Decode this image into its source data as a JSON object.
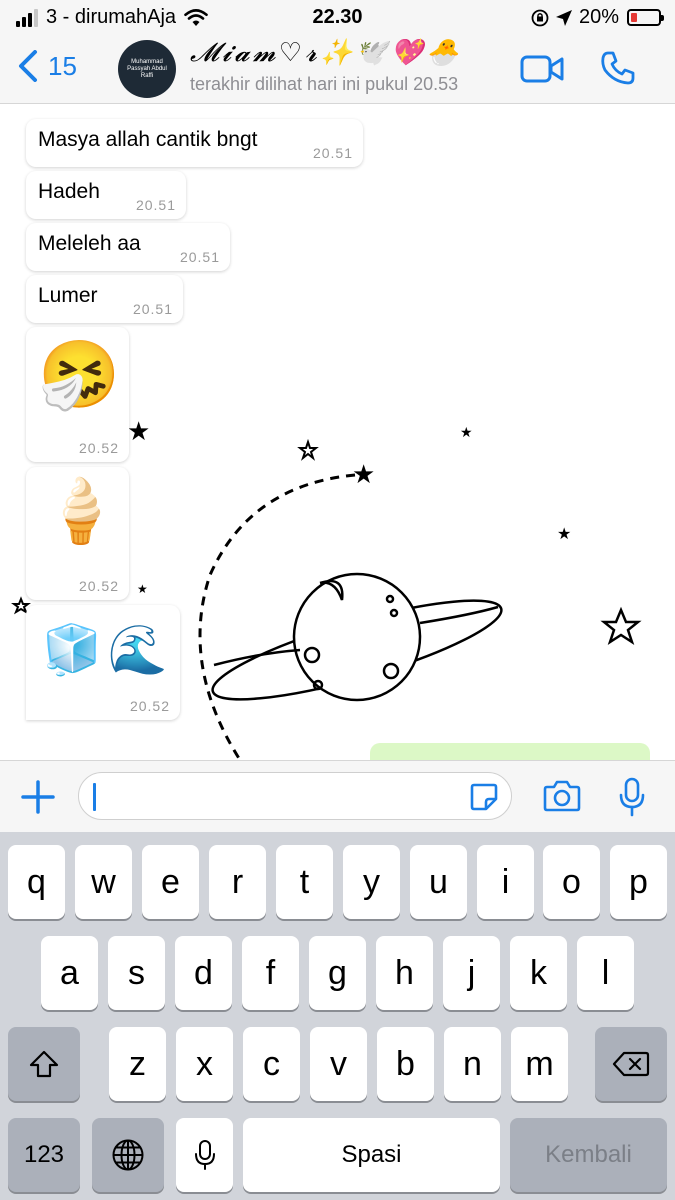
{
  "status_bar": {
    "carrier": "3 - dirumahAja",
    "time": "22.30",
    "battery": "20%"
  },
  "header": {
    "back_count": "15",
    "avatar_text": "Muhammad Passyah Abdul Raffi",
    "contact_name": "𝓜𝓲𝓪𝓶♡𝓻✨🕊️💖🐣",
    "last_seen": "terakhir dilihat hari ini pukul 20.53"
  },
  "messages": [
    {
      "text": "Masya allah cantik bngt",
      "time": "20.51"
    },
    {
      "text": "Hadeh",
      "time": "20.51"
    },
    {
      "text": "Meleleh aa",
      "time": "20.51"
    },
    {
      "text": "Lumer",
      "time": "20.51"
    },
    {
      "emoji": "🤧",
      "time": "20.52"
    },
    {
      "emoji": "🍦",
      "time": "20.52"
    },
    {
      "emoji": "🧊🌊",
      "time": "20.52"
    }
  ],
  "keyboard": {
    "row1": [
      "q",
      "w",
      "e",
      "r",
      "t",
      "y",
      "u",
      "i",
      "o",
      "p"
    ],
    "row2": [
      "a",
      "s",
      "d",
      "f",
      "g",
      "h",
      "j",
      "k",
      "l"
    ],
    "row3": [
      "z",
      "x",
      "c",
      "v",
      "b",
      "n",
      "m"
    ],
    "numbers_label": "123",
    "space_label": "Spasi",
    "return_label": "Kembali"
  },
  "colors": {
    "accent": "#1a7ee6",
    "sent_bubble": "#dcf8c6",
    "battery_low": "#e53935"
  },
  "icons": [
    "back-chevron-icon",
    "video-call-icon",
    "phone-icon",
    "plus-icon",
    "sticker-icon",
    "camera-icon",
    "microphone-icon",
    "shift-icon",
    "backspace-icon",
    "globe-icon"
  ]
}
